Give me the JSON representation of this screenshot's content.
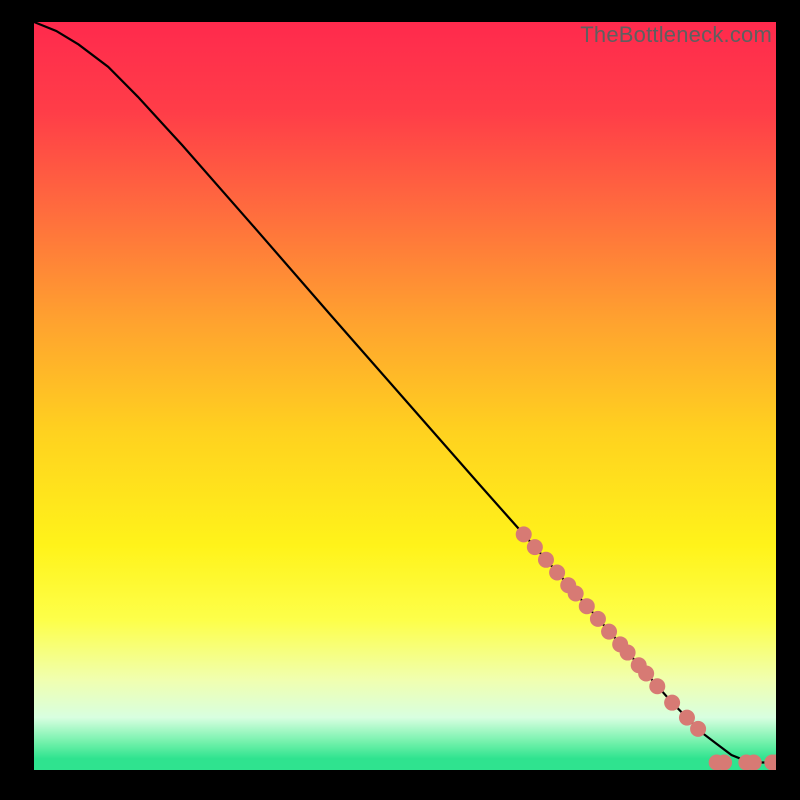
{
  "watermark": "TheBottleneck.com",
  "chart_data": {
    "type": "line",
    "title": "",
    "xlabel": "",
    "ylabel": "",
    "xlim": [
      0,
      100
    ],
    "ylim": [
      0,
      100
    ],
    "grid": false,
    "legend": false,
    "background_gradient": [
      {
        "stop": 0.0,
        "color": "#ff2a4d"
      },
      {
        "stop": 0.12,
        "color": "#ff3d48"
      },
      {
        "stop": 0.25,
        "color": "#ff6b3e"
      },
      {
        "stop": 0.4,
        "color": "#ffa22f"
      },
      {
        "stop": 0.55,
        "color": "#ffd21f"
      },
      {
        "stop": 0.7,
        "color": "#fff31a"
      },
      {
        "stop": 0.8,
        "color": "#fdff4a"
      },
      {
        "stop": 0.88,
        "color": "#f0ffb0"
      },
      {
        "stop": 0.93,
        "color": "#d8ffe0"
      },
      {
        "stop": 0.965,
        "color": "#6cf0a8"
      },
      {
        "stop": 0.985,
        "color": "#2fe38f"
      },
      {
        "stop": 1.0,
        "color": "#2fe38f"
      }
    ],
    "series": [
      {
        "name": "curve",
        "color": "#000000",
        "x": [
          0,
          3,
          6,
          10,
          14,
          20,
          30,
          40,
          50,
          60,
          66,
          70,
          74,
          78,
          82,
          86,
          88,
          90,
          92,
          94,
          96,
          98,
          100
        ],
        "y": [
          100,
          98.8,
          97.0,
          94.0,
          90.0,
          83.5,
          72.2,
          60.8,
          49.5,
          38.2,
          31.5,
          27.0,
          22.5,
          18.0,
          13.5,
          9.0,
          7.0,
          5.0,
          3.5,
          2.0,
          1.2,
          1.0,
          1.0
        ]
      }
    ],
    "markers": [
      {
        "x": 66.0,
        "y": 31.5
      },
      {
        "x": 67.5,
        "y": 29.8
      },
      {
        "x": 69.0,
        "y": 28.1
      },
      {
        "x": 70.5,
        "y": 26.4
      },
      {
        "x": 72.0,
        "y": 24.7
      },
      {
        "x": 73.0,
        "y": 23.6
      },
      {
        "x": 74.5,
        "y": 21.9
      },
      {
        "x": 76.0,
        "y": 20.2
      },
      {
        "x": 77.5,
        "y": 18.5
      },
      {
        "x": 79.0,
        "y": 16.8
      },
      {
        "x": 80.0,
        "y": 15.7
      },
      {
        "x": 81.5,
        "y": 14.0
      },
      {
        "x": 82.5,
        "y": 12.9
      },
      {
        "x": 84.0,
        "y": 11.2
      },
      {
        "x": 86.0,
        "y": 9.0
      },
      {
        "x": 88.0,
        "y": 7.0
      },
      {
        "x": 89.5,
        "y": 5.5
      },
      {
        "x": 92.0,
        "y": 1.0
      },
      {
        "x": 93.0,
        "y": 1.0
      },
      {
        "x": 96.0,
        "y": 1.0
      },
      {
        "x": 97.0,
        "y": 1.0
      },
      {
        "x": 99.5,
        "y": 1.0
      },
      {
        "x": 100.0,
        "y": 1.0
      }
    ],
    "marker_style": {
      "shape": "circle",
      "radius_px": 8,
      "fill": "#d77a74",
      "stroke": "none"
    }
  }
}
